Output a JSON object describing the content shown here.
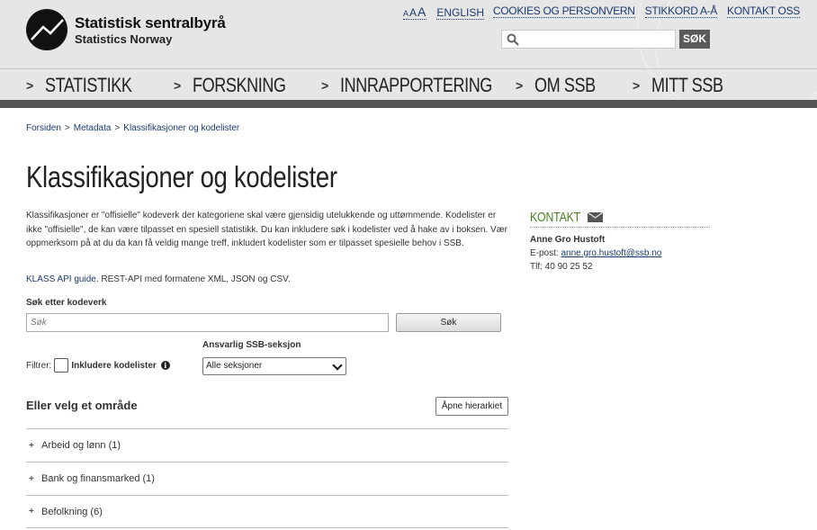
{
  "header": {
    "logo": {
      "name_no": "Statistisk sentralbyrå",
      "name_en": "Statistics Norway"
    },
    "fontsize": [
      "A",
      "A",
      "A"
    ],
    "top_links": [
      {
        "label": "ENGLISH"
      },
      {
        "label": "COOKIES OG PERSONVERN"
      },
      {
        "label": "STIKKORD A-Å"
      },
      {
        "label": "KONTAKT OSS"
      }
    ],
    "search": {
      "placeholder": "",
      "button": "SØK"
    },
    "nav": [
      {
        "label": "STATISTIKK"
      },
      {
        "label": "FORSKNING"
      },
      {
        "label": "INNRAPPORTERING"
      },
      {
        "label": "OM SSB"
      },
      {
        "label": "MITT SSB"
      }
    ]
  },
  "breadcrumb": [
    "Forsiden",
    "Metadata",
    "Klassifikasjoner og kodelister"
  ],
  "main": {
    "title": "Klassifikasjoner og kodelister",
    "intro": "Klassifikasjoner er \"offisielle\" kodeverk der kategoriene skal være gjensidig utelukkende og uttømmende. Kodelister er ikke \"offisielle\", de kan være tilpasset en spesiell statistikk. Du kan inkludere søk i kodelister ved å hake av i boksen. Vær oppmerksom på at du da kan få veldig mange treff, inkludert kodelister som er tilpasset spesielle behov i SSB.",
    "api_link": "KLASS API guide.",
    "api_text": " REST-API med formatene XML, JSON og CSV.",
    "search_label": "Søk etter kodeverk",
    "search_placeholder": "Søk",
    "search_button": "Søk",
    "filter_label": "Filtrer:",
    "filter_checkbox_label": "Inkludere kodelister",
    "section_label": "Ansvarlig SSB-seksjon",
    "section_selected": "Alle seksjoner",
    "area_heading": "Eller velg et område",
    "hierarchy_button": "Åpne hierarkiet",
    "areas": [
      {
        "label": "Arbeid og lønn (1)"
      },
      {
        "label": "Bank og finansmarked (1)"
      },
      {
        "label": "Befolkning (6)"
      }
    ]
  },
  "contact": {
    "title": "KONTAKT",
    "name": "Anne Gro Hustoft",
    "email_prefix": "E-post: ",
    "email": "anne.gro.hustoft@ssb.no",
    "phone": "Tlf: 40 90 25 52"
  },
  "colors": {
    "accent_green": "#4a7f23",
    "link": "#1a3b70",
    "nav_bar": "#555555"
  }
}
